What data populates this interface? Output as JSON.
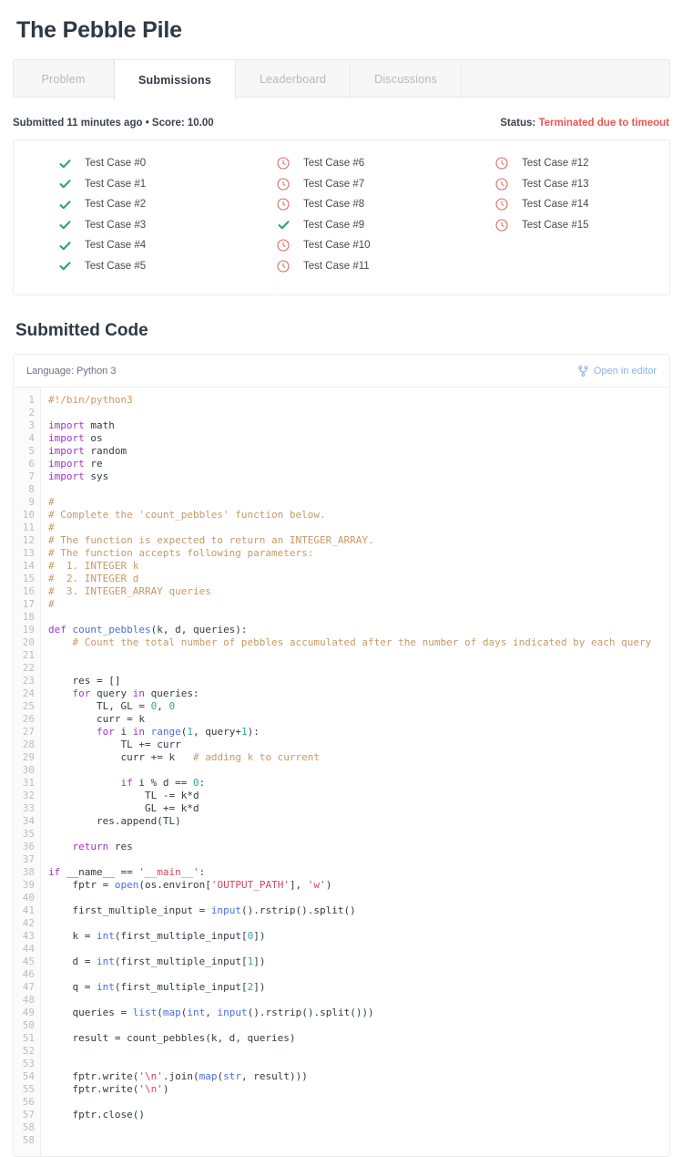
{
  "header": {
    "title": "The Pebble Pile"
  },
  "tabs": [
    {
      "label": "Problem",
      "active": false,
      "name": "tab-problem"
    },
    {
      "label": "Submissions",
      "active": true,
      "name": "tab-submissions"
    },
    {
      "label": "Leaderboard",
      "active": false,
      "name": "tab-leaderboard"
    },
    {
      "label": "Discussions",
      "active": false,
      "name": "tab-discussions"
    }
  ],
  "submission": {
    "meta": "Submitted 11 minutes ago • Score: 10.00",
    "status_label": "Status:",
    "status_value": "Terminated due to timeout",
    "status_color": "#f05650"
  },
  "test_cases": [
    {
      "label": "Test Case #0",
      "status": "passed",
      "icon": "check-icon"
    },
    {
      "label": "Test Case #1",
      "status": "passed",
      "icon": "check-icon"
    },
    {
      "label": "Test Case #2",
      "status": "passed",
      "icon": "check-icon"
    },
    {
      "label": "Test Case #3",
      "status": "passed",
      "icon": "check-icon"
    },
    {
      "label": "Test Case #4",
      "status": "passed",
      "icon": "check-icon"
    },
    {
      "label": "Test Case #5",
      "status": "passed",
      "icon": "check-icon"
    },
    {
      "label": "Test Case #6",
      "status": "timeout",
      "icon": "clock-icon"
    },
    {
      "label": "Test Case #7",
      "status": "timeout",
      "icon": "clock-icon"
    },
    {
      "label": "Test Case #8",
      "status": "timeout",
      "icon": "clock-icon"
    },
    {
      "label": "Test Case #9",
      "status": "passed",
      "icon": "check-icon"
    },
    {
      "label": "Test Case #10",
      "status": "timeout",
      "icon": "clock-icon"
    },
    {
      "label": "Test Case #11",
      "status": "timeout",
      "icon": "clock-icon"
    },
    {
      "label": "Test Case #12",
      "status": "timeout",
      "icon": "clock-icon"
    },
    {
      "label": "Test Case #13",
      "status": "timeout",
      "icon": "clock-icon"
    },
    {
      "label": "Test Case #14",
      "status": "timeout",
      "icon": "clock-icon"
    },
    {
      "label": "Test Case #15",
      "status": "timeout",
      "icon": "clock-icon"
    }
  ],
  "code_section": {
    "heading": "Submitted Code",
    "language_label": "Language: Python 3",
    "open_editor_label": "Open in editor",
    "open_editor_icon": "code-branch-icon",
    "first_line_number": 1,
    "last_line_number": 58,
    "lines": [
      [
        {
          "t": "#!/bin/python3",
          "c": "cm"
        }
      ],
      [],
      [
        {
          "t": "import",
          "c": "kw"
        },
        {
          "t": " math",
          "c": "pl"
        }
      ],
      [
        {
          "t": "import",
          "c": "kw"
        },
        {
          "t": " os",
          "c": "pl"
        }
      ],
      [
        {
          "t": "import",
          "c": "kw"
        },
        {
          "t": " random",
          "c": "pl"
        }
      ],
      [
        {
          "t": "import",
          "c": "kw"
        },
        {
          "t": " re",
          "c": "pl"
        }
      ],
      [
        {
          "t": "import",
          "c": "kw"
        },
        {
          "t": " sys",
          "c": "pl"
        }
      ],
      [],
      [
        {
          "t": "#",
          "c": "cm"
        }
      ],
      [
        {
          "t": "# Complete the 'count_pebbles' function below.",
          "c": "cm"
        }
      ],
      [
        {
          "t": "#",
          "c": "cm"
        }
      ],
      [
        {
          "t": "# The function is expected to return an INTEGER_ARRAY.",
          "c": "cm"
        }
      ],
      [
        {
          "t": "# The function accepts following parameters:",
          "c": "cm"
        }
      ],
      [
        {
          "t": "#  1. INTEGER k",
          "c": "cm"
        }
      ],
      [
        {
          "t": "#  2. INTEGER d",
          "c": "cm"
        }
      ],
      [
        {
          "t": "#  3. INTEGER_ARRAY queries",
          "c": "cm"
        }
      ],
      [
        {
          "t": "#",
          "c": "cm"
        }
      ],
      [],
      [
        {
          "t": "def",
          "c": "kw"
        },
        {
          "t": " ",
          "c": "pl"
        },
        {
          "t": "count_pebbles",
          "c": "fn"
        },
        {
          "t": "(k, d, queries):",
          "c": "pl"
        }
      ],
      [
        {
          "t": "    # Count the total number of pebbles accumulated after the number of days indicated by each query",
          "c": "cm"
        }
      ],
      [],
      [],
      [
        {
          "t": "    res = []",
          "c": "pl"
        }
      ],
      [
        {
          "t": "    ",
          "c": "pl"
        },
        {
          "t": "for",
          "c": "kw"
        },
        {
          "t": " query ",
          "c": "pl"
        },
        {
          "t": "in",
          "c": "kw"
        },
        {
          "t": " queries:",
          "c": "pl"
        }
      ],
      [
        {
          "t": "        TL, GL = ",
          "c": "pl"
        },
        {
          "t": "0",
          "c": "nu"
        },
        {
          "t": ", ",
          "c": "pl"
        },
        {
          "t": "0",
          "c": "nu"
        }
      ],
      [
        {
          "t": "        curr = k",
          "c": "pl"
        }
      ],
      [
        {
          "t": "        ",
          "c": "pl"
        },
        {
          "t": "for",
          "c": "kw"
        },
        {
          "t": " i ",
          "c": "pl"
        },
        {
          "t": "in",
          "c": "kw"
        },
        {
          "t": " ",
          "c": "pl"
        },
        {
          "t": "range",
          "c": "bi"
        },
        {
          "t": "(",
          "c": "pl"
        },
        {
          "t": "1",
          "c": "nu"
        },
        {
          "t": ", query+",
          "c": "pl"
        },
        {
          "t": "1",
          "c": "nu"
        },
        {
          "t": "):",
          "c": "pl"
        }
      ],
      [
        {
          "t": "            TL += curr",
          "c": "pl"
        }
      ],
      [
        {
          "t": "            curr += k   ",
          "c": "pl"
        },
        {
          "t": "# adding k to current",
          "c": "cm"
        }
      ],
      [],
      [
        {
          "t": "            ",
          "c": "pl"
        },
        {
          "t": "if",
          "c": "kw"
        },
        {
          "t": " i % d == ",
          "c": "pl"
        },
        {
          "t": "0",
          "c": "nu"
        },
        {
          "t": ":",
          "c": "pl"
        }
      ],
      [
        {
          "t": "                TL -= k*d",
          "c": "pl"
        }
      ],
      [
        {
          "t": "                GL += k*d",
          "c": "pl"
        }
      ],
      [
        {
          "t": "        res.append(TL)",
          "c": "pl"
        }
      ],
      [],
      [
        {
          "t": "    ",
          "c": "pl"
        },
        {
          "t": "return",
          "c": "kw"
        },
        {
          "t": " res",
          "c": "pl"
        }
      ],
      [],
      [
        {
          "t": "if",
          "c": "kw"
        },
        {
          "t": " __name__ == ",
          "c": "pl"
        },
        {
          "t": "'__main__'",
          "c": "st"
        },
        {
          "t": ":",
          "c": "pl"
        }
      ],
      [
        {
          "t": "    fptr = ",
          "c": "pl"
        },
        {
          "t": "open",
          "c": "bi"
        },
        {
          "t": "(os.environ[",
          "c": "pl"
        },
        {
          "t": "'OUTPUT_PATH'",
          "c": "st"
        },
        {
          "t": "], ",
          "c": "pl"
        },
        {
          "t": "'w'",
          "c": "st"
        },
        {
          "t": ")",
          "c": "pl"
        }
      ],
      [],
      [
        {
          "t": "    first_multiple_input = ",
          "c": "pl"
        },
        {
          "t": "input",
          "c": "bi"
        },
        {
          "t": "().rstrip().split()",
          "c": "pl"
        }
      ],
      [],
      [
        {
          "t": "    k = ",
          "c": "pl"
        },
        {
          "t": "int",
          "c": "bi"
        },
        {
          "t": "(first_multiple_input[",
          "c": "pl"
        },
        {
          "t": "0",
          "c": "nu"
        },
        {
          "t": "])",
          "c": "pl"
        }
      ],
      [],
      [
        {
          "t": "    d = ",
          "c": "pl"
        },
        {
          "t": "int",
          "c": "bi"
        },
        {
          "t": "(first_multiple_input[",
          "c": "pl"
        },
        {
          "t": "1",
          "c": "nu"
        },
        {
          "t": "])",
          "c": "pl"
        }
      ],
      [],
      [
        {
          "t": "    q = ",
          "c": "pl"
        },
        {
          "t": "int",
          "c": "bi"
        },
        {
          "t": "(first_multiple_input[",
          "c": "pl"
        },
        {
          "t": "2",
          "c": "nu"
        },
        {
          "t": "])",
          "c": "pl"
        }
      ],
      [],
      [
        {
          "t": "    queries = ",
          "c": "pl"
        },
        {
          "t": "list",
          "c": "bi"
        },
        {
          "t": "(",
          "c": "pl"
        },
        {
          "t": "map",
          "c": "bi"
        },
        {
          "t": "(",
          "c": "pl"
        },
        {
          "t": "int",
          "c": "bi"
        },
        {
          "t": ", ",
          "c": "pl"
        },
        {
          "t": "input",
          "c": "bi"
        },
        {
          "t": "().rstrip().split()))",
          "c": "pl"
        }
      ],
      [],
      [
        {
          "t": "    result = count_pebbles(k, d, queries)",
          "c": "pl"
        }
      ],
      [],
      [],
      [
        {
          "t": "    fptr.write(",
          "c": "pl"
        },
        {
          "t": "'\\n'",
          "c": "st"
        },
        {
          "t": ".join(",
          "c": "pl"
        },
        {
          "t": "map",
          "c": "bi"
        },
        {
          "t": "(",
          "c": "pl"
        },
        {
          "t": "str",
          "c": "bi"
        },
        {
          "t": ", result)))",
          "c": "pl"
        }
      ],
      [
        {
          "t": "    fptr.write(",
          "c": "pl"
        },
        {
          "t": "'\\n'",
          "c": "st"
        },
        {
          "t": ")",
          "c": "pl"
        }
      ],
      [],
      [
        {
          "t": "    fptr.close()",
          "c": "pl"
        }
      ],
      []
    ]
  }
}
